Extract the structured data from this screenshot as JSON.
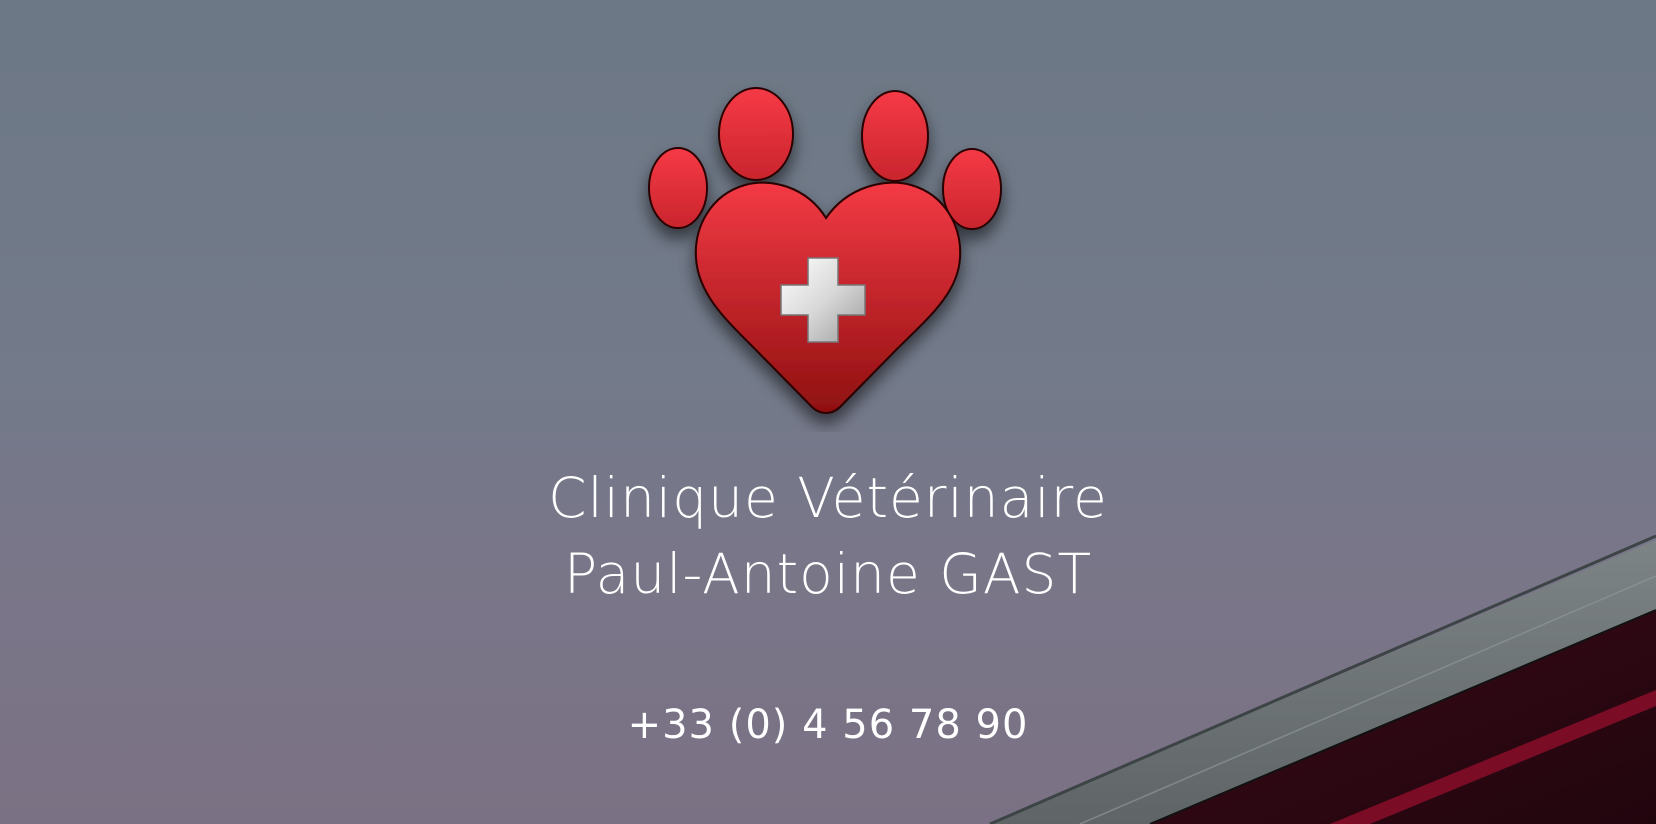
{
  "hero": {
    "clinic_name_line1": "Clinique Vétérinaire",
    "clinic_name_line2": "Paul-Antoine GAST",
    "phone": "+33 (0) 4 56 78 90"
  },
  "logo": {
    "icon": "paw-heart-cross-icon",
    "colors": {
      "red_light": "#f43a45",
      "red_dark": "#8f1010",
      "cross": "#e6e6e6"
    }
  },
  "background": {
    "sky_top": "#6c7885",
    "sky_bottom": "#7b7184",
    "roof_accent": "#5a0018"
  }
}
